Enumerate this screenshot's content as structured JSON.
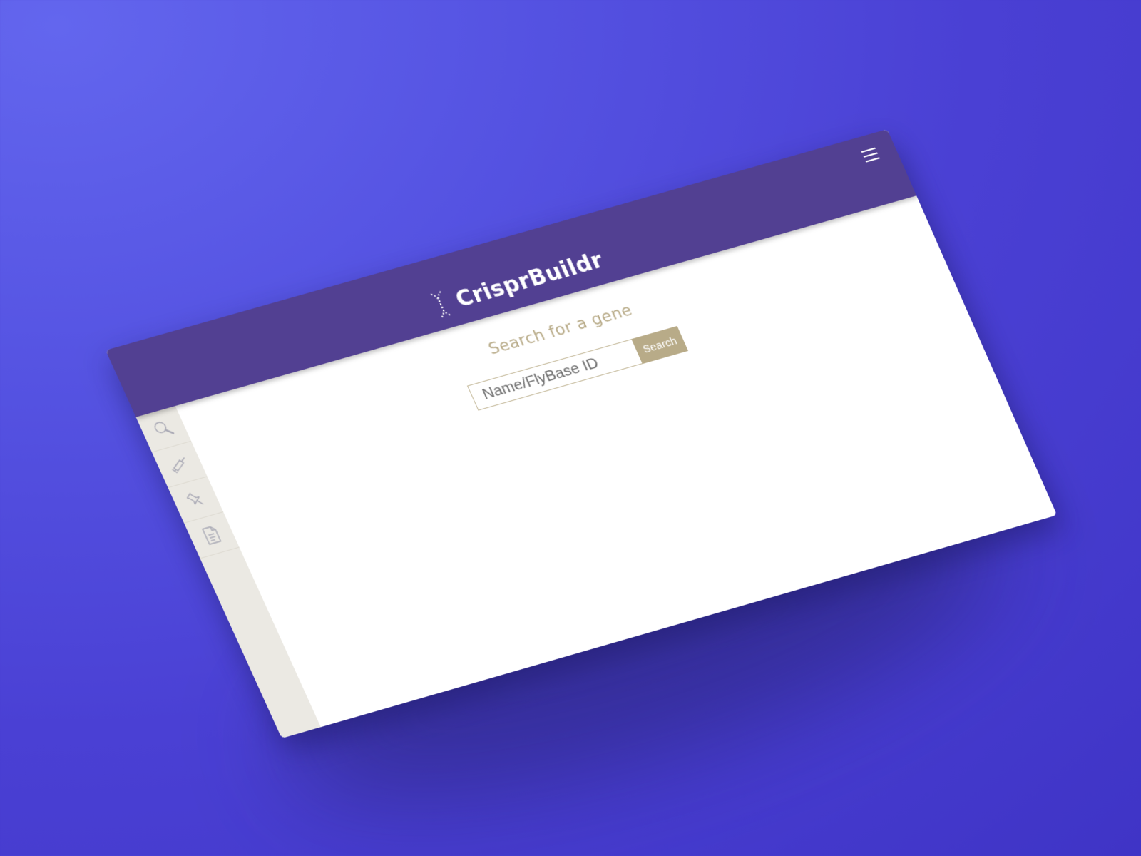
{
  "app": {
    "brand": "CrisprBuildr"
  },
  "header": {
    "menu_icon": "hamburger-menu-icon",
    "logo_icon": "dna-helix-icon"
  },
  "sidebar": {
    "items": [
      {
        "icon": "search-icon"
      },
      {
        "icon": "syringe-icon"
      },
      {
        "icon": "pin-icon"
      },
      {
        "icon": "document-icon"
      }
    ]
  },
  "search": {
    "title": "Search for a gene",
    "placeholder": "Name/FlyBase ID",
    "value": "",
    "button_label": "Search"
  },
  "colors": {
    "background": "#4a40d4",
    "header": "#524092",
    "accent": "#b8ab88",
    "sidebar": "#ebe9e3",
    "content": "#ffffff"
  }
}
